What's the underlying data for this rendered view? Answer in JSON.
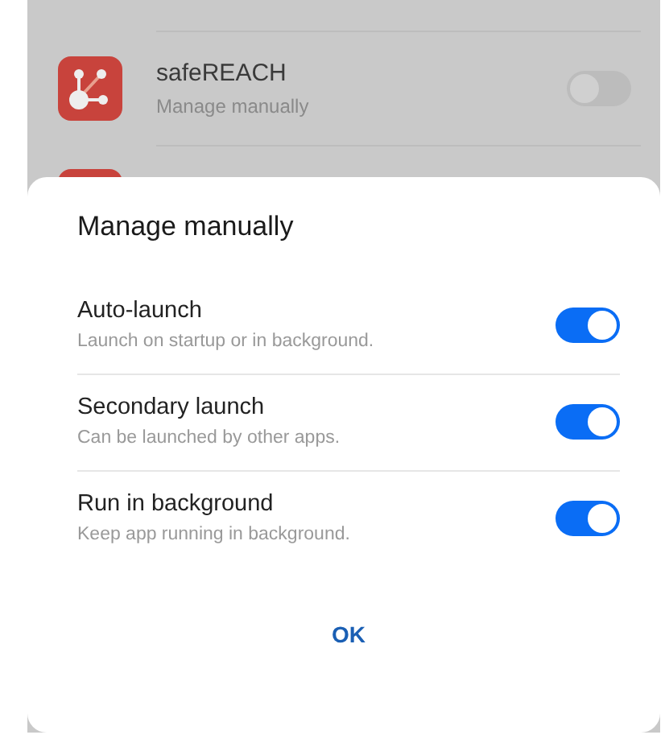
{
  "app_list": [
    {
      "name": "safeREACH",
      "status": "Manage manually",
      "on": false
    }
  ],
  "dialog": {
    "title": "Manage manually",
    "options": [
      {
        "label": "Auto-launch",
        "description": "Launch on startup or in background.",
        "on": true
      },
      {
        "label": "Secondary launch",
        "description": "Can be launched by other apps.",
        "on": true
      },
      {
        "label": "Run in background",
        "description": "Keep app running in background.",
        "on": true
      }
    ],
    "button": "OK"
  }
}
